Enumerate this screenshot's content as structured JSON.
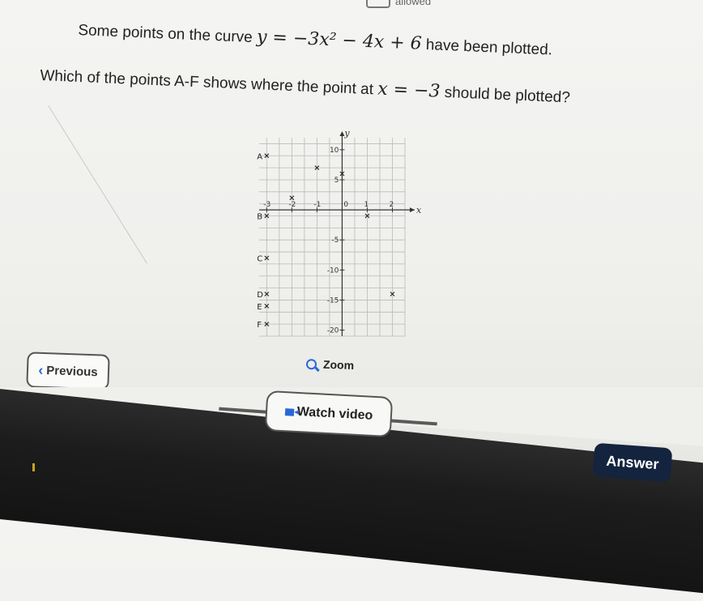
{
  "header": {
    "allowed_text": "allowed"
  },
  "question": {
    "line1_pre": "Some points on the curve ",
    "line1_math": "y = −3x² − 4x + 6",
    "line1_post": " have been plotted.",
    "line2_pre": "Which of the points A-F shows where the point at ",
    "line2_math": "x = −3",
    "line2_post": " should be plotted?"
  },
  "graph": {
    "y_axis_label": "y",
    "x_axis_label": "x",
    "x_tick_labels": [
      "-3",
      "-2",
      "-1",
      "0",
      "1",
      "2"
    ],
    "y_tick_labels": [
      "10",
      "5",
      "-5",
      "-10",
      "-15",
      "-20"
    ],
    "point_labels": [
      "A",
      "B",
      "C",
      "D",
      "E",
      "F"
    ],
    "options": [
      {
        "label": "A",
        "x": -3,
        "y": 9
      },
      {
        "label": "B",
        "x": -3,
        "y": -1
      },
      {
        "label": "C",
        "x": -3,
        "y": -8
      },
      {
        "label": "D",
        "x": -3,
        "y": -14
      },
      {
        "label": "E",
        "x": -3,
        "y": -16
      },
      {
        "label": "F",
        "x": -3,
        "y": -19
      }
    ],
    "plotted_points": [
      {
        "x": -2,
        "y": 2
      },
      {
        "x": -1,
        "y": 7
      },
      {
        "x": 0,
        "y": 6
      },
      {
        "x": 1,
        "y": -1
      },
      {
        "x": 2,
        "y": -14
      }
    ],
    "xlim": [
      -3.3,
      2.5
    ],
    "ylim": [
      -21,
      12
    ]
  },
  "buttons": {
    "zoom": "Zoom",
    "previous": "Previous",
    "watch_video": "Watch video",
    "answer": "Answer"
  },
  "colors": {
    "accent": "#2b66d9",
    "answer_bg": "#14233e"
  }
}
